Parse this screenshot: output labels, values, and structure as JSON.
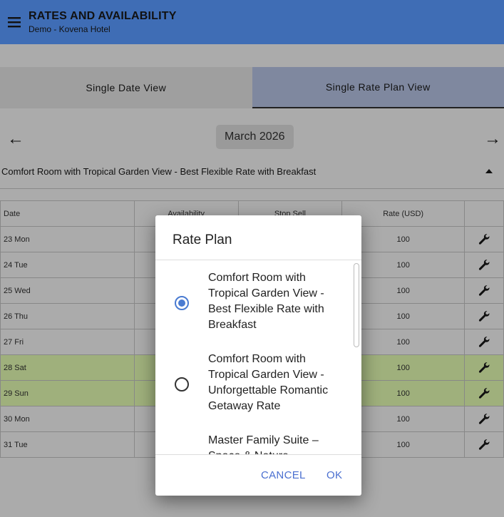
{
  "appbar": {
    "title": "RATES AND AVAILABILITY",
    "subtitle": "Demo - Kovena Hotel"
  },
  "tabs": [
    {
      "label": "Single Date View",
      "active": false
    },
    {
      "label": "Single Rate Plan View",
      "active": true
    }
  ],
  "month": {
    "label": "March 2026",
    "prev_arrow": "←",
    "next_arrow": "→"
  },
  "rate_plan_selector": {
    "label": "Comfort Room with Tropical Garden View - Best Flexible Rate with Breakfast"
  },
  "table": {
    "headers": [
      "Date",
      "Availability",
      "Stop Sell",
      "Rate (USD)",
      ""
    ],
    "rows": [
      {
        "date": "23 Mon",
        "rate": "100",
        "weekend": false
      },
      {
        "date": "24 Tue",
        "rate": "100",
        "weekend": false
      },
      {
        "date": "25 Wed",
        "rate": "100",
        "weekend": false
      },
      {
        "date": "26 Thu",
        "rate": "100",
        "weekend": false
      },
      {
        "date": "27 Fri",
        "rate": "100",
        "weekend": false
      },
      {
        "date": "28 Sat",
        "rate": "100",
        "weekend": true
      },
      {
        "date": "29 Sun",
        "rate": "100",
        "weekend": true
      },
      {
        "date": "30 Mon",
        "rate": "100",
        "weekend": false
      },
      {
        "date": "31 Tue",
        "rate": "100",
        "weekend": false
      }
    ]
  },
  "dialog": {
    "title": "Rate Plan",
    "options": [
      {
        "label": "Comfort Room with Tropical Garden View - Best Flexible Rate with Breakfast",
        "selected": true
      },
      {
        "label": "Comfort Room with Tropical Garden View - Unforgettable Romantic Getaway Rate",
        "selected": false
      },
      {
        "label": "Master Family Suite – Space & Nature",
        "selected": false
      }
    ],
    "cancel_label": "CANCEL",
    "ok_label": "OK"
  },
  "colors": {
    "appbar": "#3f6db5",
    "accent": "#4a7bd1",
    "weekend_row": "#9fb07c"
  }
}
